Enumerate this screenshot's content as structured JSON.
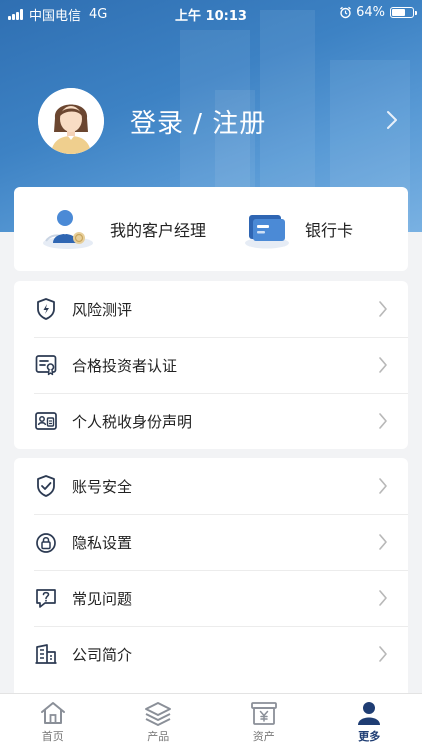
{
  "status_bar": {
    "carrier": "中国电信",
    "network": "4G",
    "time": "上午 10:13",
    "battery": "64%"
  },
  "profile": {
    "login_label": "登录 / 注册"
  },
  "quick_actions": [
    {
      "label": "我的客户经理",
      "icon": "account-manager-icon"
    },
    {
      "label": "银行卡",
      "icon": "bank-card-icon"
    }
  ],
  "menu_group_1": [
    {
      "label": "风险测评",
      "icon": "shield-bolt-icon"
    },
    {
      "label": "合格投资者认证",
      "icon": "certificate-icon"
    },
    {
      "label": "个人税收身份声明",
      "icon": "tax-id-card-icon"
    }
  ],
  "menu_group_2": [
    {
      "label": "账号安全",
      "icon": "shield-check-icon"
    },
    {
      "label": "隐私设置",
      "icon": "lock-icon"
    },
    {
      "label": "常见问题",
      "icon": "question-icon"
    },
    {
      "label": "公司简介",
      "icon": "building-icon"
    }
  ],
  "tab_bar": [
    {
      "label": "首页",
      "icon": "home-icon",
      "active": false
    },
    {
      "label": "产品",
      "icon": "layers-icon",
      "active": false
    },
    {
      "label": "资产",
      "icon": "wallet-yen-icon",
      "active": false
    },
    {
      "label": "更多",
      "icon": "person-icon",
      "active": true
    }
  ],
  "colors": {
    "header": "#3d82c4",
    "accent": "#1f3d73",
    "background": "#f2f3f5"
  }
}
